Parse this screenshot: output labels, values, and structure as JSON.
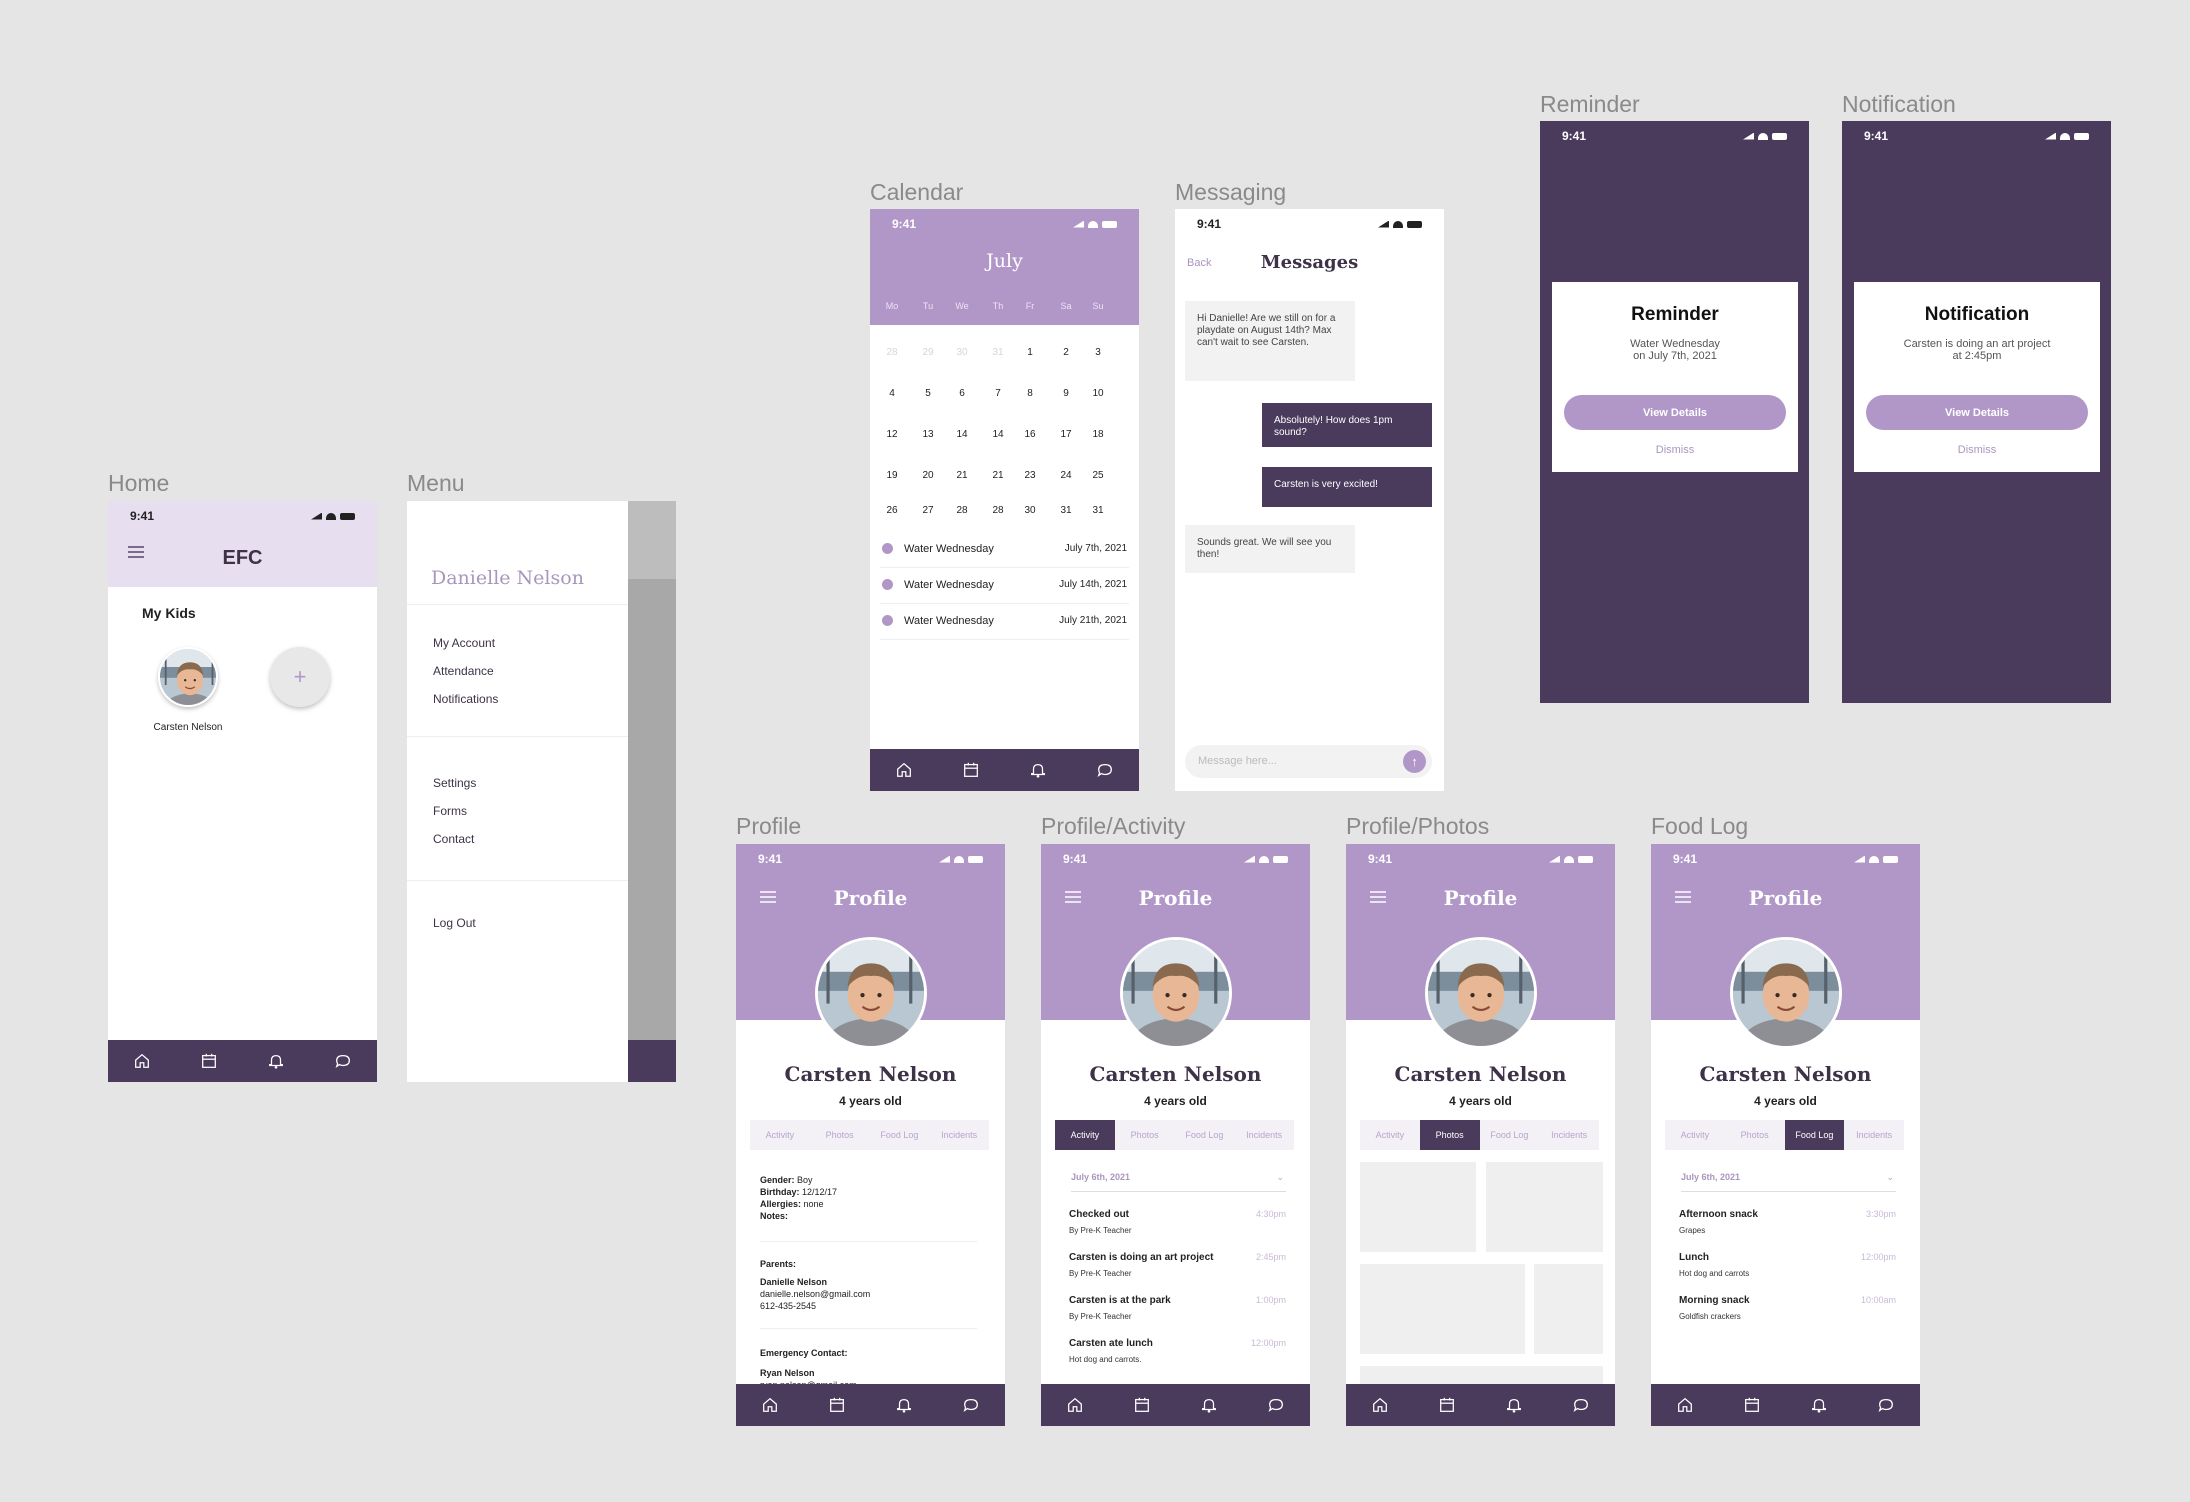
{
  "status_time": "9:41",
  "icons": {
    "home": "home-icon",
    "calendar": "calendar-icon",
    "bell": "bell-icon",
    "chat": "chat-icon",
    "menu": "hamburger-icon",
    "add": "plus-icon",
    "send": "send-icon",
    "chevron": "chevron-down-icon"
  },
  "colors": {
    "purple_dark": "#4a3a5c",
    "purple_light": "#b197c8",
    "lavender_header": "#e7dff0",
    "canvas": "#e5e5e5"
  },
  "frames": {
    "home": "Home",
    "menu": "Menu",
    "calendar": "Calendar",
    "messaging": "Messaging",
    "reminder": "Reminder",
    "notification": "Notification",
    "profile": "Profile",
    "profile_activity": "Profile/Activity",
    "profile_photos": "Profile/Photos",
    "food_log": "Food Log"
  },
  "home": {
    "title": "EFC",
    "section": "My Kids",
    "kid_name": "Carsten Nelson",
    "add_label": "+"
  },
  "menu": {
    "user": "Danielle Nelson",
    "group1": [
      "My Account",
      "Attendance",
      "Notifications"
    ],
    "group2": [
      "Settings",
      "Forms",
      "Contact"
    ],
    "logout": "Log Out"
  },
  "calendar": {
    "month": "July",
    "weekdays": [
      "Mo",
      "Tu",
      "We",
      "Th",
      "Fr",
      "Sa",
      "Su"
    ],
    "weeks": [
      [
        "28",
        "29",
        "30",
        "31",
        "1",
        "2",
        "3"
      ],
      [
        "4",
        "5",
        "6",
        "7",
        "8",
        "9",
        "10"
      ],
      [
        "12",
        "13",
        "14",
        "14",
        "16",
        "17",
        "18"
      ],
      [
        "19",
        "20",
        "21",
        "21",
        "23",
        "24",
        "25"
      ],
      [
        "26",
        "27",
        "28",
        "28",
        "30",
        "31",
        "31"
      ]
    ],
    "events": [
      {
        "name": "Water Wednesday",
        "date": "July 7th, 2021"
      },
      {
        "name": "Water Wednesday",
        "date": "July 14th, 2021"
      },
      {
        "name": "Water Wednesday",
        "date": "July 21th, 2021"
      }
    ]
  },
  "messaging": {
    "back": "Back",
    "title": "Messages",
    "m1": "Hi Danielle! Are we still on for a playdate on August 14th? Max can't wait to see Carsten.",
    "m2": "Absolutely! How does 1pm sound?",
    "m3": "Carsten is very excited!",
    "m4": "Sounds great. We will see you then!",
    "placeholder": "Message here..."
  },
  "reminder": {
    "title": "Reminder",
    "line1": "Water Wednesday",
    "line2": "on July 7th, 2021",
    "button": "View Details",
    "dismiss": "Dismiss"
  },
  "notification": {
    "title": "Notification",
    "line1": "Carsten is doing an art project",
    "line2": "at 2:45pm",
    "button": "View Details",
    "dismiss": "Dismiss"
  },
  "profile": {
    "header": "Profile",
    "name": "Carsten Nelson",
    "age": "4 years old",
    "tabs": [
      "Activity",
      "Photos",
      "Food Log",
      "Incidents"
    ],
    "gender_label": "Gender:",
    "gender": "Boy",
    "birthday_label": "Birthday:",
    "birthday": "12/12/17",
    "allergies_label": "Allergies:",
    "allergies": "none",
    "notes_label": "Notes:",
    "parents_label": "Parents:",
    "parent_name": "Danielle Nelson",
    "parent_email": "danielle.nelson@gmail.com",
    "parent_phone": "612-435-2545",
    "emergency_label": "Emergency Contact:",
    "emergency_name": "Ryan Nelson",
    "emergency_email": "ryan.nelson@gmail.com"
  },
  "activity": {
    "date": "July 6th, 2021",
    "items": [
      {
        "title": "Checked out",
        "sub": "By Pre-K Teacher",
        "time": "4:30pm"
      },
      {
        "title": "Carsten is doing an art project",
        "sub": "By Pre-K Teacher",
        "time": "2:45pm"
      },
      {
        "title": "Carsten is at the park",
        "sub": "By Pre-K Teacher",
        "time": "1:00pm"
      },
      {
        "title": "Carsten ate lunch",
        "sub": "Hot dog and carrots.",
        "time": "12:00pm"
      }
    ]
  },
  "food": {
    "date": "July 6th, 2021",
    "items": [
      {
        "title": "Afternoon snack",
        "sub": "Grapes",
        "time": "3:30pm"
      },
      {
        "title": "Lunch",
        "sub": "Hot dog and carrots",
        "time": "12:00pm"
      },
      {
        "title": "Morning snack",
        "sub": "Goldfish crackers",
        "time": "10:00am"
      }
    ]
  }
}
